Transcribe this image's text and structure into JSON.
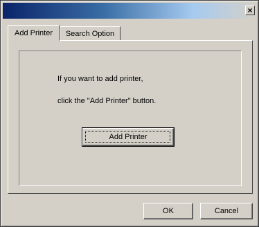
{
  "window": {
    "title": "",
    "close_glyph": "×"
  },
  "tabs": [
    {
      "label": "Add Printer",
      "active": true
    },
    {
      "label": "Search Option",
      "active": false
    }
  ],
  "panel": {
    "message_line1": "If you want to add printer,",
    "message_line2": "click the \"Add Printer\" button.",
    "add_printer_label": "Add Printer"
  },
  "footer": {
    "ok_label": "OK",
    "cancel_label": "Cancel"
  },
  "colors": {
    "title_start": "#0a246a",
    "title_end": "#d4d0c8",
    "face": "#d4d0c8"
  },
  "icons": {
    "close": "close-icon"
  }
}
